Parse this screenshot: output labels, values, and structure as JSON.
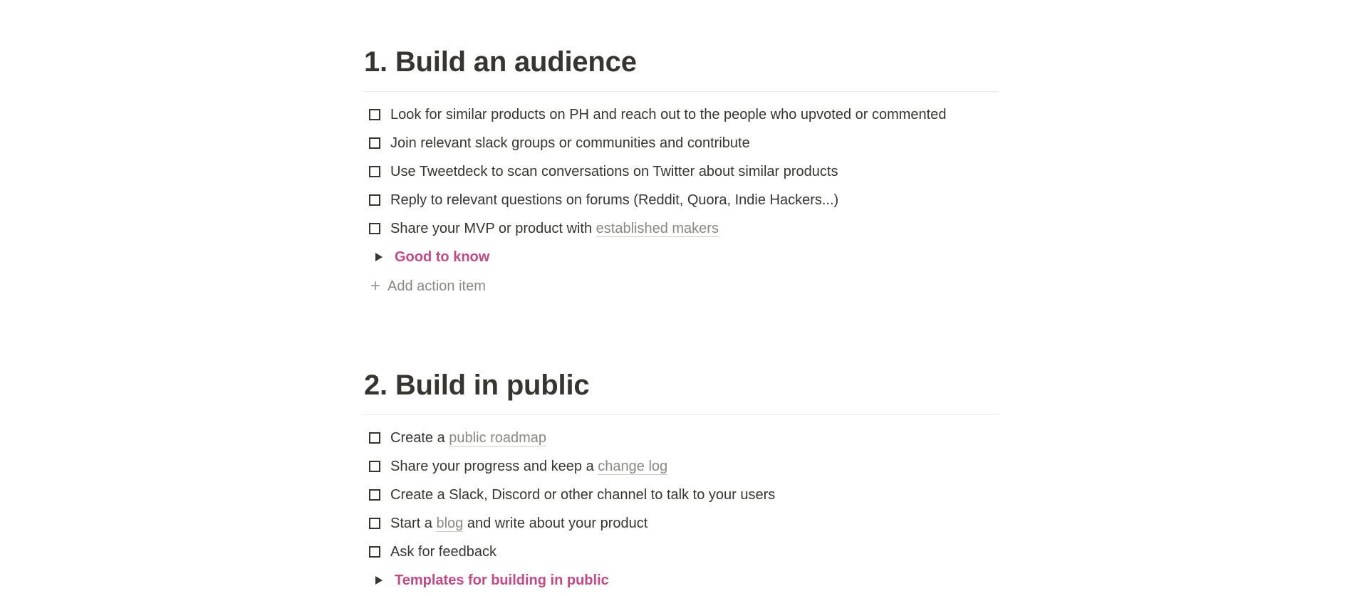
{
  "sections": [
    {
      "heading": "1. Build an audience",
      "todos": [
        {
          "text": "Look for similar products on PH and reach out to the people who upvoted or commented"
        },
        {
          "text": "Join relevant slack groups or communities and contribute"
        },
        {
          "text": "Use Tweetdeck to scan conversations on Twitter about similar products"
        },
        {
          "text": "Reply to relevant questions on forums (Reddit, Quora, Indie Hackers...)"
        },
        {
          "text_before": "Share your MVP or product with ",
          "link": "established makers",
          "text_after": ""
        }
      ],
      "toggle": "Good to know",
      "add_action": "Add action item"
    },
    {
      "heading": "2. Build in public",
      "todos": [
        {
          "text_before": "Create a ",
          "link": "public roadmap",
          "text_after": ""
        },
        {
          "text_before": "Share your progress and keep a ",
          "link": "change log",
          "text_after": ""
        },
        {
          "text": "Create a Slack, Discord or other channel to talk to your users"
        },
        {
          "text_before": "Start a ",
          "link": "blog",
          "text_after": " and write about your product"
        },
        {
          "text": "Ask for feedback"
        }
      ],
      "toggle": "Templates for building in public"
    }
  ],
  "colors": {
    "text": "#37352f",
    "toggle_accent": "#c14a86",
    "link_muted": "#8a8883",
    "divider": "#e9e9e7"
  },
  "icons": {
    "checkbox": "checkbox-icon",
    "toggle": "triangle-right-icon",
    "add": "plus-icon"
  }
}
